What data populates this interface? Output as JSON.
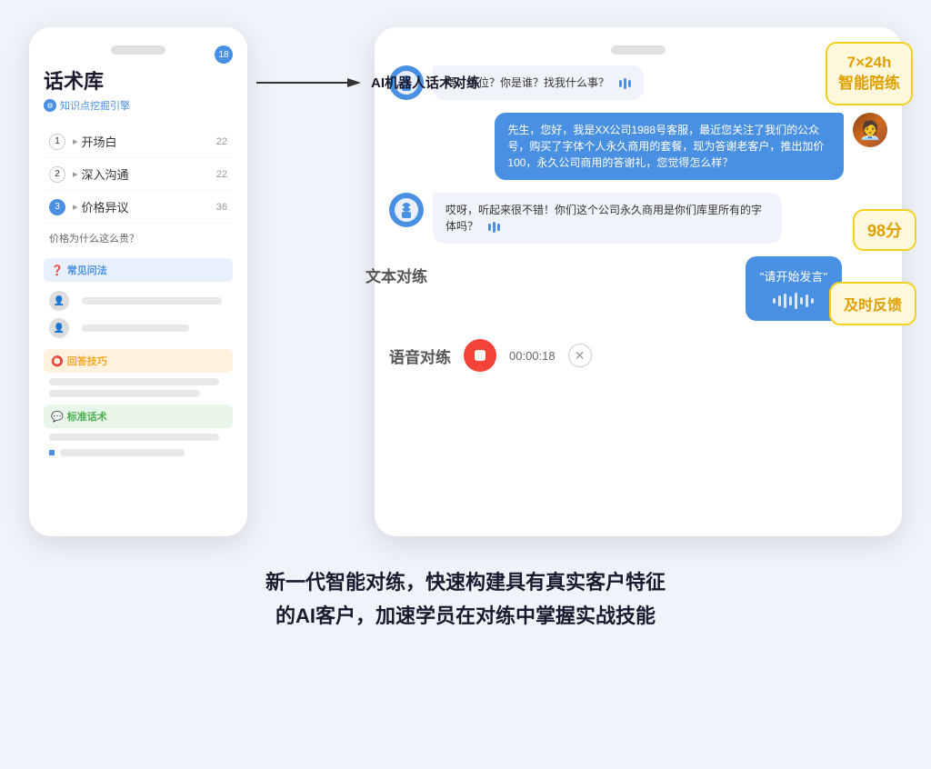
{
  "page": {
    "bg_color": "#f0f4fa"
  },
  "left_phone": {
    "title": "话术库",
    "subtitle": "知识点挖掘引擎",
    "badge": "18",
    "menu_items": [
      {
        "num": "1",
        "active": false,
        "label": "开场白",
        "count": "22"
      },
      {
        "num": "2",
        "active": false,
        "label": "深入沟通",
        "count": "22"
      },
      {
        "num": "3",
        "active": true,
        "label": "价格异议",
        "count": "36"
      }
    ],
    "question": "价格为什么这么贵？",
    "sections": [
      {
        "label": "常见问法",
        "type": "blue"
      },
      {
        "label": "回答技巧",
        "type": "orange"
      },
      {
        "label": "标准话术",
        "type": "green"
      }
    ]
  },
  "arrow": {
    "label": "AI机器人话术对练"
  },
  "right_phone": {
    "messages": [
      {
        "type": "bot",
        "text": "喂，哪位？你是谁？找我什么事？",
        "has_sound": true
      },
      {
        "type": "user",
        "text": "先生，您好，我是XX公司1988号客服，最近您关注了我们的公众号，购买了字体个人永久商用的套餐，现为答谢老客户，推出加价100，永久公司商用的答谢礼，您觉得怎么样？"
      },
      {
        "type": "bot",
        "text": "哎呀，听起来很不错！你们这个公司永久商用是你们库里所有的字体吗？",
        "has_sound": true
      },
      {
        "type": "voice_input",
        "placeholder": "\"请开始发言\""
      }
    ],
    "voice_timer": "00:00:18",
    "score": "98分",
    "label_text_practice": "文本对练",
    "label_voice_practice": "语音对练",
    "label_724": "7×24h\n智能陪练",
    "label_feedback": "及时反馈"
  },
  "bottom_text": "新一代智能对练，快速构建具有真实客户特征\n的AI客户，加速学员在对练中掌握实战技能"
}
